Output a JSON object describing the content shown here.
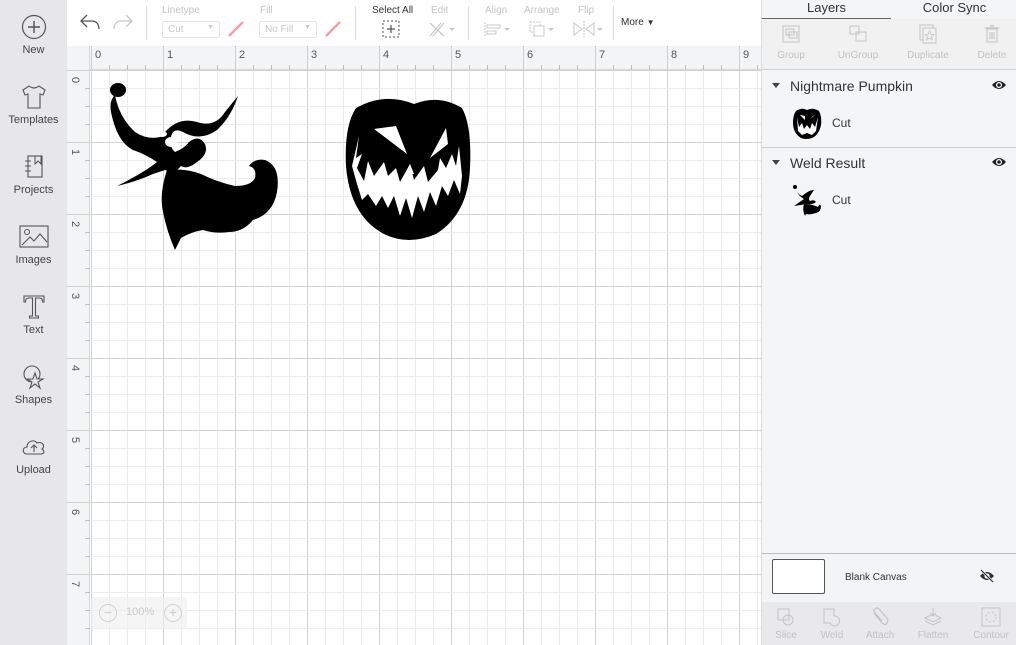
{
  "sidebar": {
    "items": [
      {
        "label": "New",
        "icon": "plus-circle-icon"
      },
      {
        "label": "Templates",
        "icon": "tshirt-icon"
      },
      {
        "label": "Projects",
        "icon": "notebook-icon"
      },
      {
        "label": "Images",
        "icon": "image-icon"
      },
      {
        "label": "Text",
        "icon": "text-t-icon"
      },
      {
        "label": "Shapes",
        "icon": "shapes-icon"
      },
      {
        "label": "Upload",
        "icon": "cloud-upload-icon"
      }
    ]
  },
  "toolbar": {
    "undo_icon": "undo-icon",
    "redo_icon": "redo-icon",
    "linetype_label": "Linetype",
    "linetype_value": "Cut",
    "fill_label": "Fill",
    "fill_value": "No Fill",
    "select_all_label": "Select All",
    "edit_label": "Edit",
    "align_label": "Align",
    "arrange_label": "Arrange",
    "flip_label": "Flip",
    "more_label": "More",
    "swatch_color": "#f0a0a8"
  },
  "canvas": {
    "ruler_top": [
      "0",
      "1",
      "2",
      "3",
      "4",
      "5",
      "6",
      "7",
      "8",
      "9"
    ],
    "ruler_left": [
      "0",
      "1",
      "2",
      "3",
      "4",
      "5",
      "6",
      "7"
    ],
    "zoom_level": "100%",
    "zoom_out_label": "−",
    "zoom_in_label": "+",
    "objects": [
      {
        "name": "Weld Result",
        "shape": "zero-ghost-dog"
      },
      {
        "name": "Nightmare Pumpkin",
        "shape": "jack-o-lantern"
      }
    ]
  },
  "panel": {
    "tabs": [
      "Layers",
      "Color Sync"
    ],
    "active_tab": "Layers",
    "tools": [
      "Group",
      "UnGroup",
      "Duplicate",
      "Delete"
    ],
    "groups": [
      {
        "name": "Nightmare Pumpkin",
        "layers": [
          {
            "type": "Cut"
          }
        ]
      },
      {
        "name": "Weld Result",
        "layers": [
          {
            "type": "Cut"
          }
        ]
      }
    ],
    "blank_canvas_label": "Blank Canvas",
    "bottom_tools": [
      "Slice",
      "Weld",
      "Attach",
      "Flatten",
      "Contour"
    ]
  }
}
